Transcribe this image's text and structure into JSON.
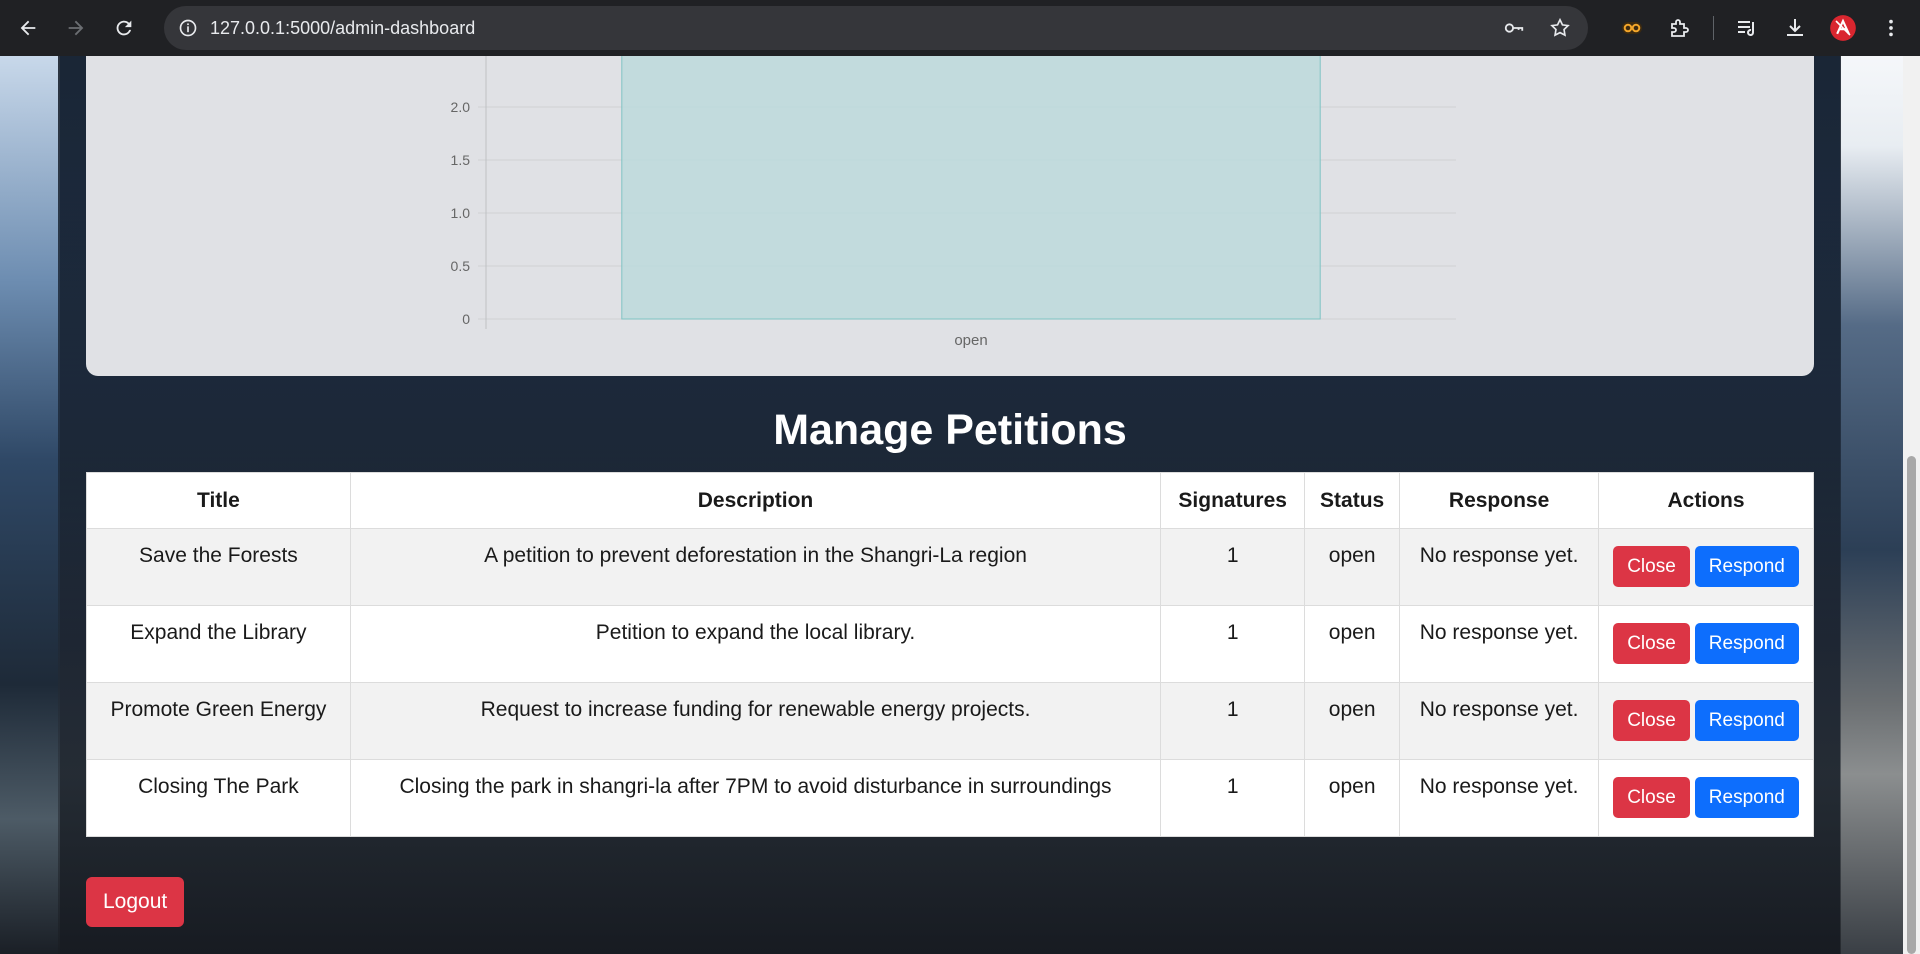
{
  "browser": {
    "url_host": "127.0.0.1",
    "url_path": ":5000/admin-dashboard"
  },
  "chart_data": {
    "type": "bar",
    "categories": [
      "open"
    ],
    "values": [
      2.5
    ],
    "y_tick_labels": [
      "0",
      "0.5",
      "1.0",
      "1.5",
      "2.0"
    ],
    "ylim": [
      0,
      2.5
    ],
    "bar_color": "#bcd9dc",
    "bar_border": "#7fc4c4"
  },
  "page": {
    "heading": "Manage Petitions",
    "table": {
      "headers": [
        "Title",
        "Description",
        "Signatures",
        "Status",
        "Response",
        "Actions"
      ],
      "rows": [
        {
          "title": "Save the Forests",
          "description": "A petition to prevent deforestation in the Shangri-La region",
          "signatures": "1",
          "status": "open",
          "response": "No response yet."
        },
        {
          "title": "Expand the Library",
          "description": "Petition to expand the local library.",
          "signatures": "1",
          "status": "open",
          "response": "No response yet."
        },
        {
          "title": "Promote Green Energy",
          "description": "Request to increase funding for renewable energy projects.",
          "signatures": "1",
          "status": "open",
          "response": "No response yet."
        },
        {
          "title": "Closing The Park",
          "description": "Closing the park in shangri-la after 7PM to avoid disturbance in surroundings",
          "signatures": "1",
          "status": "open",
          "response": "No response yet."
        }
      ]
    },
    "actions": {
      "close_label": "Close",
      "respond_label": "Respond"
    },
    "logout_label": "Logout"
  },
  "colors": {
    "danger": "#dc3545",
    "primary": "#0d6efd"
  }
}
